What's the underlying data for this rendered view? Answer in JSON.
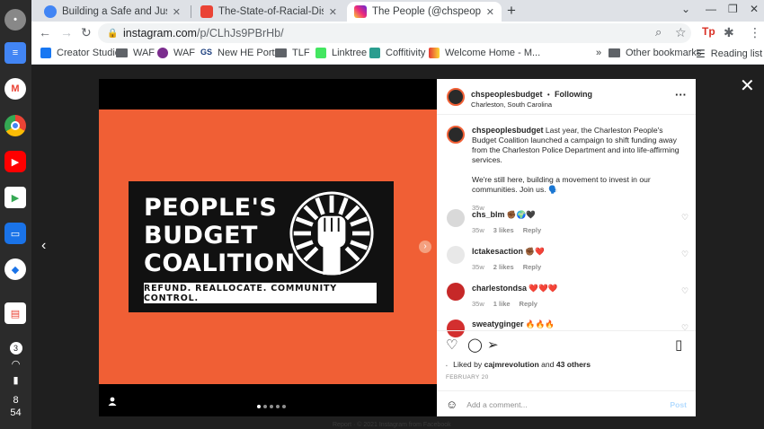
{
  "browser": {
    "tabs": [
      {
        "title": "Building a Safe and Just Charlest",
        "favicon_color": "#4285f4"
      },
      {
        "title": "The-State-of-Racial-Disparities-in",
        "favicon_color": "#ea4335"
      },
      {
        "title": "The People (@chspeoplesbudge",
        "favicon_color": "#c13584"
      }
    ],
    "new_tab": "+",
    "url_domain": "instagram.com",
    "url_path": "/p/CLhJs9PBrHb/",
    "bookmarks": [
      "Creator Studio",
      "WAF",
      "WAF",
      "New HE Portal",
      "TLF",
      "Linktree",
      "Coffitivity",
      "Welcome Home - M..."
    ],
    "other_bookmarks": "Other bookmarks",
    "reading_list": "Reading list"
  },
  "shelf": {
    "status_badge": "3",
    "time_hour": "8",
    "time_min": "54"
  },
  "post": {
    "image": {
      "line1": "PEOPLE'S",
      "line2": "BUDGET",
      "line3": "COALITION",
      "subline": "REFUND. REALLOCATE. COMMUNITY CONTROL."
    },
    "header": {
      "username": "chspeoplesbudget",
      "dot": "•",
      "follow": "Following",
      "location": "Charleston, South Carolina"
    },
    "caption": {
      "username": "chspeoplesbudget",
      "text1": "Last year, the Charleston People's Budget Coalition launched a campaign to shift funding away from the Charleston Police Department and into life-affirming services.",
      "text2": "We're still here, building a movement to invest in our communities. Join us. 🗣️",
      "age": "35w"
    },
    "comments": [
      {
        "user": "chs_blm",
        "text": "✊🏾🌍🖤",
        "age": "35w",
        "likes": "3 likes",
        "reply": "Reply"
      },
      {
        "user": "lctakesaction",
        "text": "✊🏾❤️",
        "age": "35w",
        "likes": "2 likes",
        "reply": "Reply"
      },
      {
        "user": "charlestondsa",
        "text": "❤️❤️❤️",
        "age": "35w",
        "likes": "1 like",
        "reply": "Reply"
      },
      {
        "user": "sweatyginger",
        "text": "🔥🔥🔥",
        "age": "",
        "likes": "",
        "reply": ""
      }
    ],
    "liked_by_prefix": "Liked by",
    "liked_by_user": "cajmrevolution",
    "liked_by_and": "and",
    "liked_by_count": "43 others",
    "date": "FEBRUARY 20",
    "add_comment_placeholder": "Add a comment...",
    "post_button": "Post"
  },
  "footer": "Report · © 2021 Instagram from Facebook"
}
